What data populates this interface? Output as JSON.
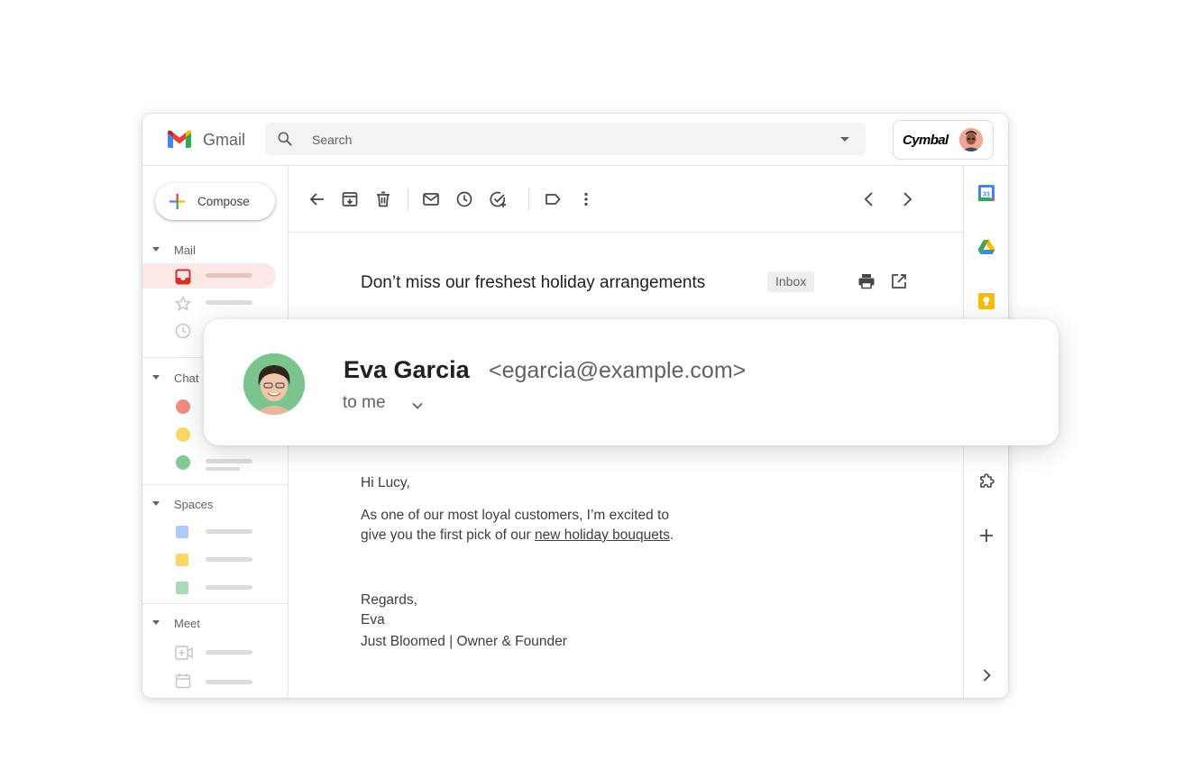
{
  "app": {
    "name": "Gmail"
  },
  "search": {
    "placeholder": "Search"
  },
  "account": {
    "brand": "Cymbal"
  },
  "compose": {
    "label": "Compose"
  },
  "sidebar": {
    "sections": {
      "mail": "Mail",
      "chat": "Chat",
      "spaces": "Spaces",
      "meet": "Meet"
    },
    "chat_dot_colors": [
      "#f28b82",
      "#fdd663",
      "#81c995"
    ],
    "space_colors": [
      "#aecbfa",
      "#fdd663",
      "#a8dab5"
    ]
  },
  "message": {
    "subject": "Don’t miss our freshest holiday arrangements",
    "label": "Inbox",
    "sender_name": "Eva Garcia",
    "sender_email": "<egarcia@example.com>",
    "recipient": "to me",
    "greeting": "Hi Lucy,",
    "body_line1": "As one of our most loyal customers, I’m excited to",
    "body_line2_prefix": "give you the first pick of our ",
    "body_link": "new holiday bouquets",
    "body_line2_suffix": ".",
    "closing": "Regards,",
    "sign_name": "Eva",
    "sign_title": "Just Bloomed | Owner & Founder"
  },
  "side_panel": {
    "calendar_day": "31"
  },
  "colors": {
    "gmail_red": "#ea4335",
    "gmail_blue": "#4285f4",
    "gmail_green": "#34a853",
    "gmail_yellow": "#fbbc04",
    "active_nav_bg": "#fce8e6"
  }
}
